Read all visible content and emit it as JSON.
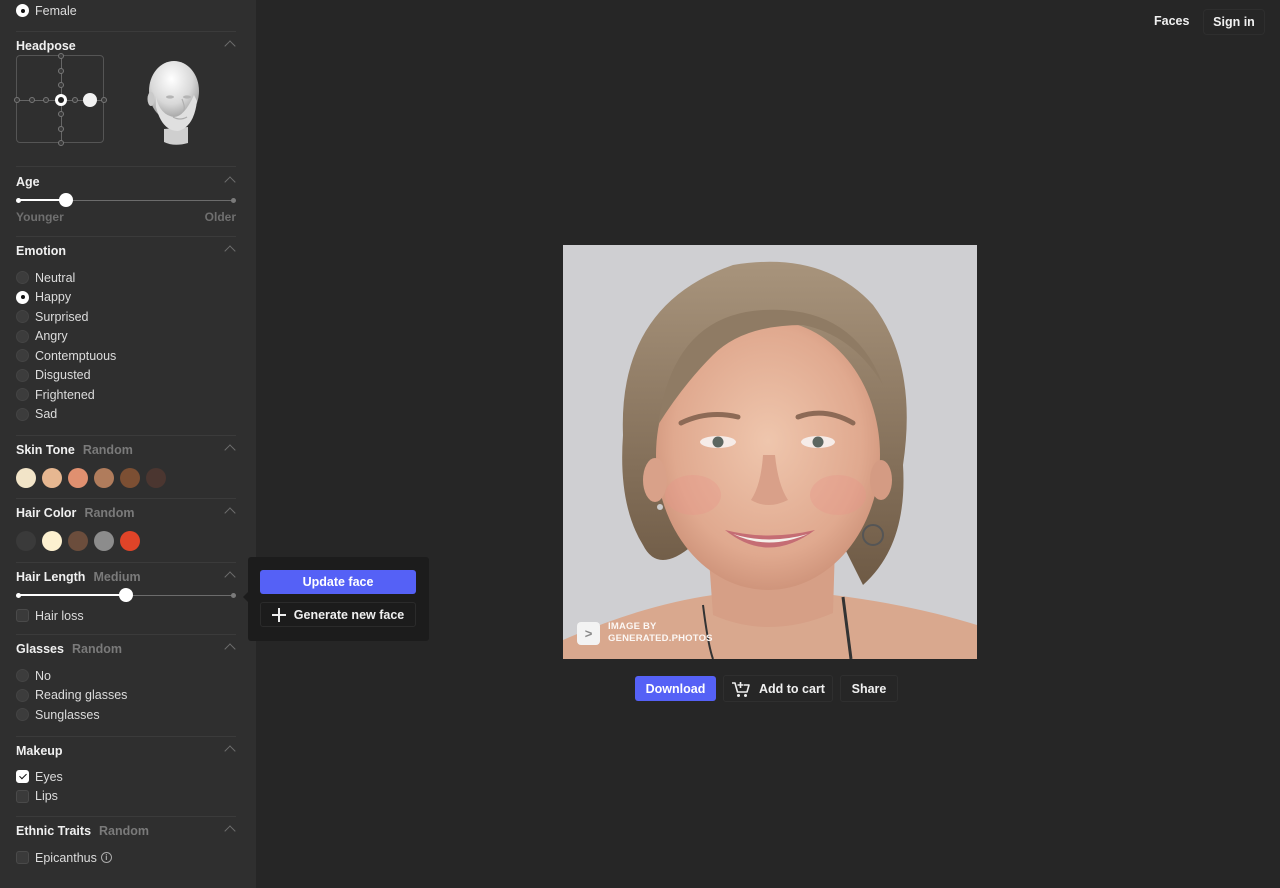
{
  "nav": {
    "faces": "Faces",
    "sign_in": "Sign in"
  },
  "sidebar": {
    "sex": {
      "options": [
        {
          "label": "Female",
          "selected": true
        }
      ]
    },
    "headpose": {
      "title": "Headpose",
      "yaw_step": 2,
      "pitch_step": 0
    },
    "age": {
      "title": "Age",
      "value": 0.22,
      "min_label": "Younger",
      "max_label": "Older"
    },
    "emotion": {
      "title": "Emotion",
      "options": [
        {
          "label": "Neutral",
          "selected": false
        },
        {
          "label": "Happy",
          "selected": true
        },
        {
          "label": "Surprised",
          "selected": false
        },
        {
          "label": "Angry",
          "selected": false
        },
        {
          "label": "Contemptuous",
          "selected": false
        },
        {
          "label": "Disgusted",
          "selected": false
        },
        {
          "label": "Frightened",
          "selected": false
        },
        {
          "label": "Sad",
          "selected": false
        }
      ]
    },
    "skin_tone": {
      "title": "Skin Tone",
      "value": "Random",
      "swatches": [
        "#f2e4c8",
        "#e6b791",
        "#e09070",
        "#b07c5c",
        "#7c4f33",
        "#4b3630"
      ]
    },
    "hair_color": {
      "title": "Hair Color",
      "value": "Random",
      "swatches": [
        "#3a3a3a",
        "#fdf1d0",
        "#6b4d3c",
        "#8c8c8c",
        "#e04428"
      ]
    },
    "hair_length": {
      "title": "Hair Length",
      "value": "Medium",
      "slider": 0.5,
      "hair_loss": {
        "label": "Hair loss",
        "checked": false
      }
    },
    "glasses": {
      "title": "Glasses",
      "value": "Random",
      "options": [
        {
          "label": "No",
          "selected": false
        },
        {
          "label": "Reading glasses",
          "selected": false
        },
        {
          "label": "Sunglasses",
          "selected": false
        }
      ]
    },
    "makeup": {
      "title": "Makeup",
      "options": [
        {
          "label": "Eyes",
          "checked": true
        },
        {
          "label": "Lips",
          "checked": false
        }
      ]
    },
    "ethnic": {
      "title": "Ethnic Traits",
      "value": "Random",
      "options": [
        {
          "label": "Epicanthus",
          "checked": false,
          "info": "i"
        }
      ]
    }
  },
  "popover": {
    "update": "Update face",
    "generate": "Generate new face"
  },
  "image": {
    "watermark_line1": "IMAGE BY",
    "watermark_line2": "GENERATED.PHOTOS",
    "watermark_logo": ">"
  },
  "actions": {
    "download": "Download",
    "add_to_cart": "Add to cart",
    "share": "Share"
  },
  "colors": {
    "accent": "#5561f6",
    "sidebar_bg": "#2f2f2f",
    "main_bg": "#262626",
    "popover_bg": "#1c1c1c"
  }
}
